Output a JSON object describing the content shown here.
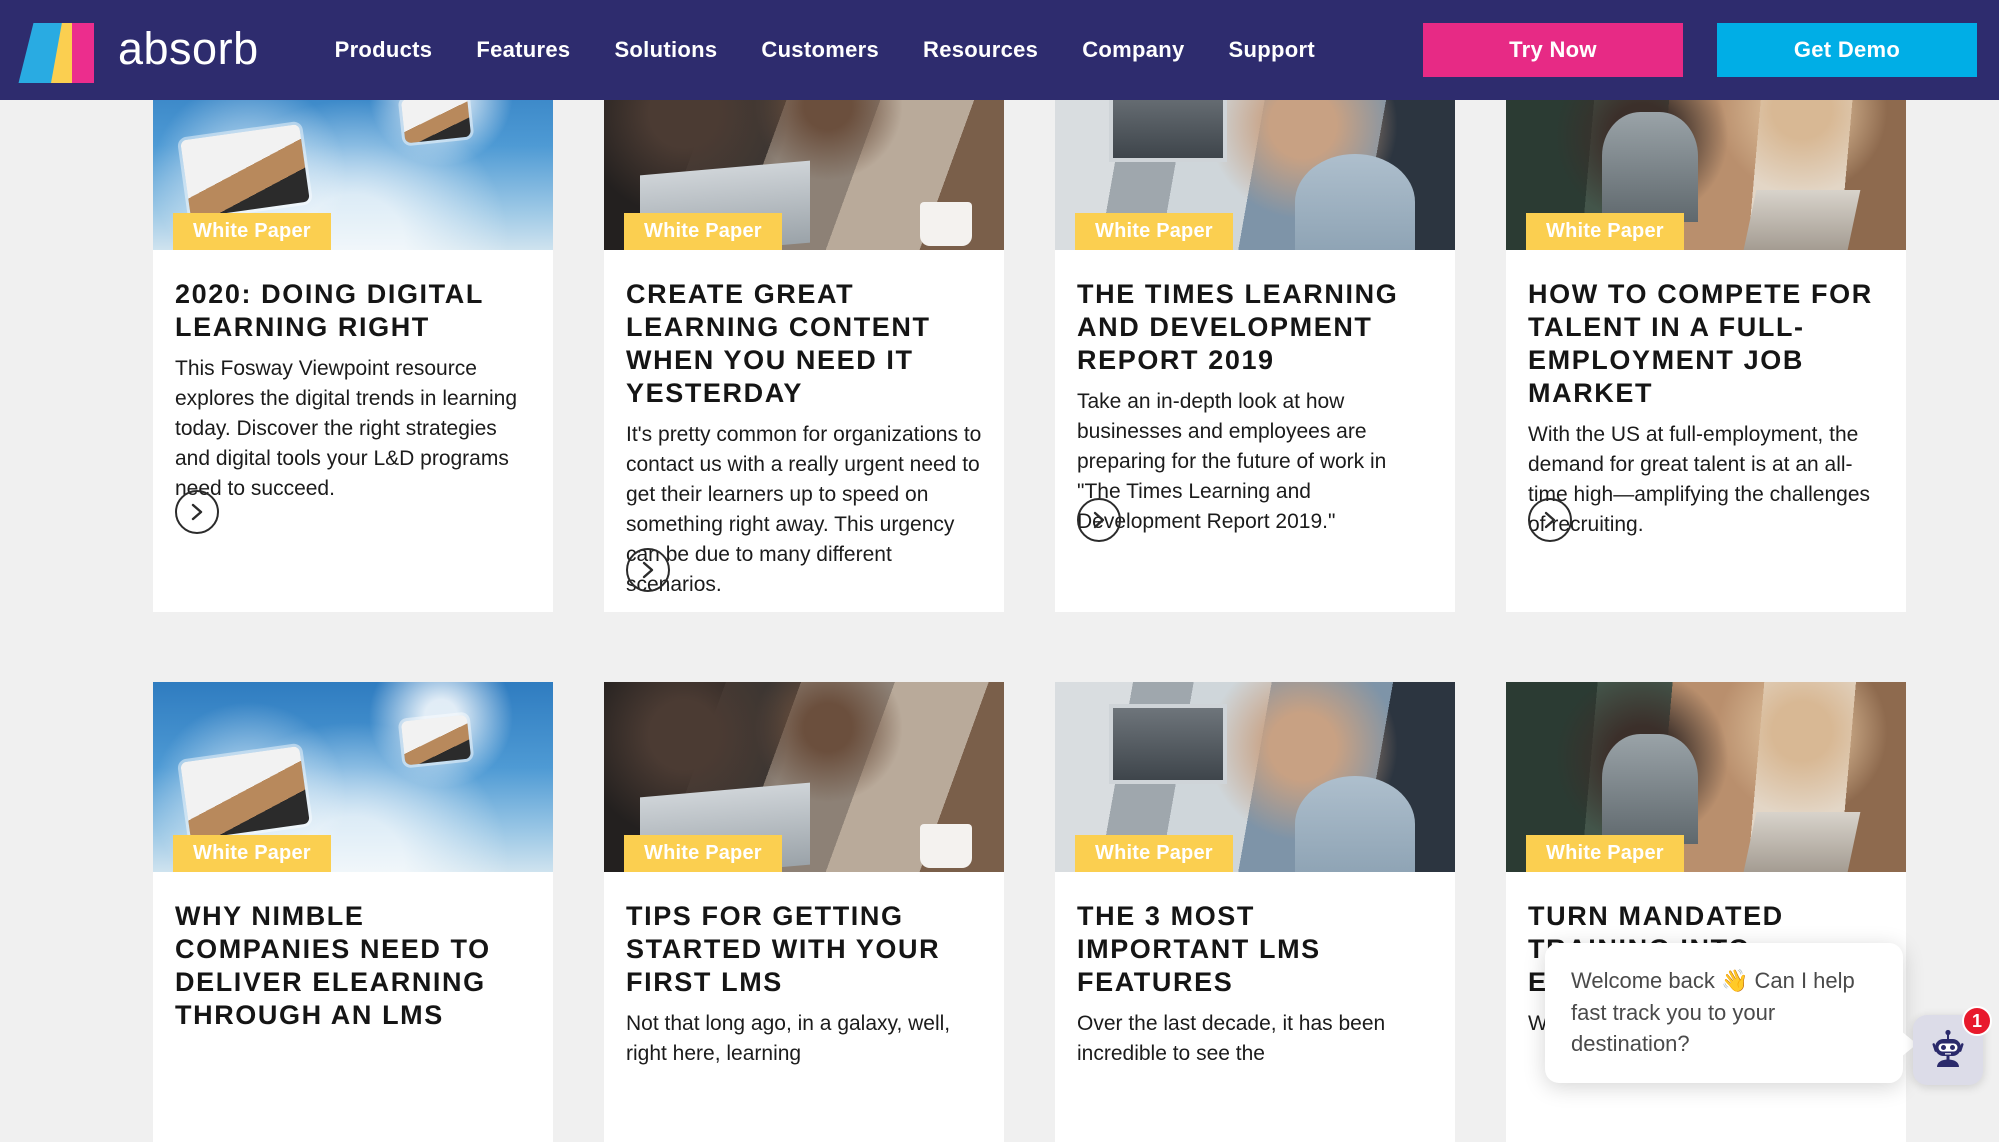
{
  "navbar": {
    "brand_name": "absorb",
    "logo_colors": {
      "cyan": "#29ABE2",
      "yellow": "#FBCF50",
      "pink": "#EC2D8D"
    },
    "background": "#2E2C6E",
    "links": [
      {
        "label": "Products"
      },
      {
        "label": "Features"
      },
      {
        "label": "Solutions"
      },
      {
        "label": "Customers"
      },
      {
        "label": "Resources"
      },
      {
        "label": "Company"
      },
      {
        "label": "Support"
      }
    ],
    "buttons": [
      {
        "label": "Try Now",
        "color": "#E72A85"
      },
      {
        "label": "Get Demo",
        "color": "#00AEE6"
      }
    ]
  },
  "page": {
    "background": "#F0F0F0",
    "badge_color": "#FBCF50",
    "rows": [
      {
        "id": "row-1",
        "cards": [
          {
            "badge": "White Paper",
            "title": "2020: Doing Digital Learning Right",
            "description": "This Fosway Viewpoint resource explores the digital trends in learning today. Discover the right strategies and digital tools your L&D programs need to succeed.",
            "arrow": "chevron-right",
            "media": ""
          },
          {
            "badge": "White Paper",
            "title": "Create Great Learning Content When You Need It Yesterday",
            "description": "It's pretty common for organizations to contact us with a really urgent need to get their learners up to speed on something right away. This urgency can be due to many different scenarios.",
            "arrow": "chevron-right",
            "media": ""
          },
          {
            "badge": "White Paper",
            "title": "The Times Learning and Development Report 2019",
            "description": "Take an in-depth look at how businesses and employees are preparing for the future of work in \"The Times Learning and Development Report 2019.\"",
            "arrow": "chevron-right",
            "media": ""
          },
          {
            "badge": "White Paper",
            "title": "How to Compete for Talent in a Full-Employment Job Market",
            "description": "With the US at full-employment, the demand for great talent is at an all-time high—amplifying the challenges of recruiting.",
            "arrow": "chevron-right",
            "media": ""
          }
        ]
      },
      {
        "id": "row-2",
        "cards": [
          {
            "badge": "White Paper",
            "title": "Why Nimble Companies Need to Deliver eLearning Through an LMS",
            "description": "",
            "arrow": "chevron-right",
            "media": "delivery-drones-photo"
          },
          {
            "badge": "White Paper",
            "title": "Tips for Getting Started With Your First LMS",
            "description": "Not that long ago, in a galaxy, well, right here, learning",
            "arrow": "chevron-right",
            "media": "two-men-at-laptop-photo"
          },
          {
            "badge": "White Paper",
            "title": "The 3 Most Important LMS Features",
            "description": "Over the last decade, it has been incredible to see the",
            "arrow": "chevron-right",
            "media": "woman-at-monitor-photo"
          },
          {
            "badge": "White Paper",
            "title": "Turn Mandated Training Into Engaging eLearning",
            "description": "While building and maintaining",
            "arrow": "chevron-right",
            "media": "two-women-studying-photo"
          }
        ]
      }
    ]
  },
  "chat": {
    "message": "Welcome back 👋 Can I help fast track you to your destination?",
    "unread_count": "1",
    "avatar": "robot-avatar",
    "badge_color": "#E8192C"
  }
}
